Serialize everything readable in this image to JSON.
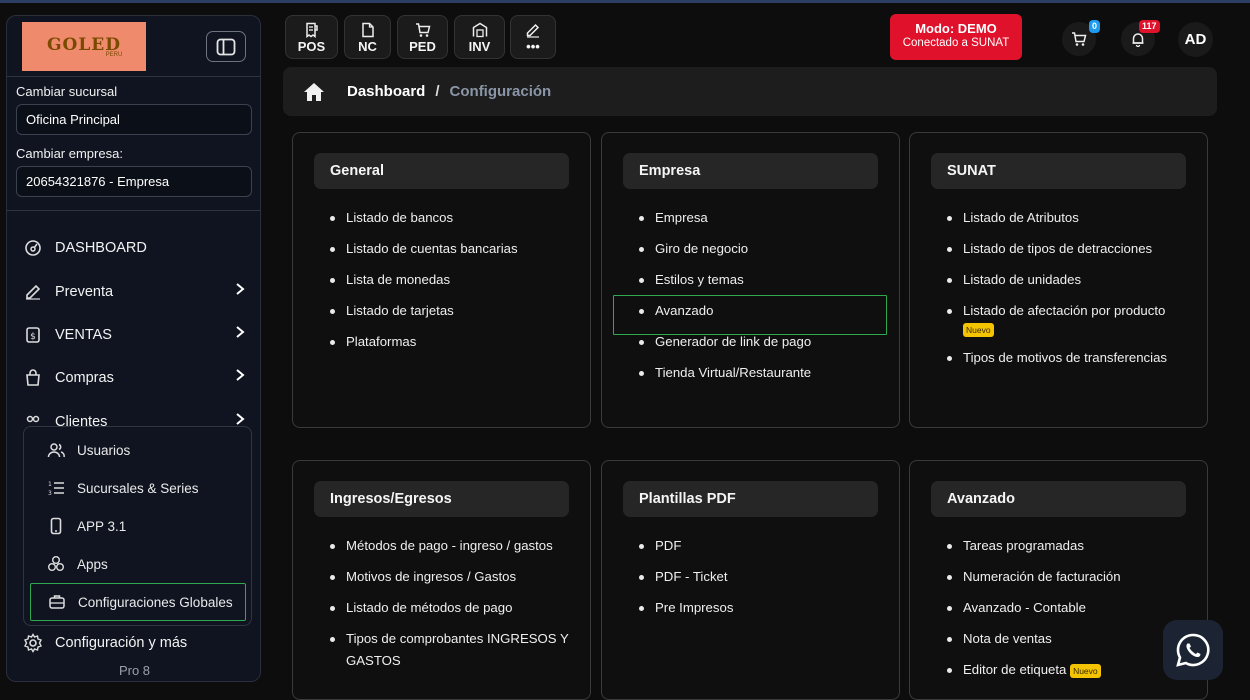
{
  "sidebar": {
    "logo_text": "GOLED",
    "logo_sub": "PERU",
    "branch_label": "Cambiar sucursal",
    "branch_value": "Oficina Principal",
    "company_label": "Cambiar empresa:",
    "company_value": "20654321876 - Empresa",
    "nav": [
      {
        "label": "DASHBOARD",
        "icon": "dashboard-icon"
      },
      {
        "label": "Preventa",
        "icon": "edit-icon"
      },
      {
        "label": "VENTAS",
        "icon": "money-icon"
      },
      {
        "label": "Compras",
        "icon": "bag-icon"
      },
      {
        "label": "Clientes",
        "icon": "users-icon"
      }
    ],
    "submenu": [
      {
        "label": "Usuarios",
        "icon": "users-icon"
      },
      {
        "label": "Sucursales & Series",
        "icon": "list-icon"
      },
      {
        "label": "APP 3.1",
        "icon": "phone-icon"
      },
      {
        "label": "Apps",
        "icon": "apps-icon"
      },
      {
        "label": "Configuraciones Globales",
        "icon": "briefcase-icon",
        "selected": true
      }
    ],
    "settings_label": "Configuración y más",
    "version": "Pro 8"
  },
  "toolbar": [
    {
      "label": "POS",
      "icon": "receipt-icon"
    },
    {
      "label": "NC",
      "icon": "file-icon"
    },
    {
      "label": "PED",
      "icon": "cart-icon"
    },
    {
      "label": "INV",
      "icon": "warehouse-icon"
    },
    {
      "label": "•••",
      "icon": "edit-icon"
    }
  ],
  "demo": {
    "title": "Modo: DEMO",
    "subtitle": "Conectado a SUNAT"
  },
  "cart_count": "0",
  "notif_count": "117",
  "avatar": "AD",
  "breadcrumb": {
    "home": "home-icon",
    "first": "Dashboard",
    "separator": "/",
    "current": "Configuración"
  },
  "nuevo_label": "Nuevo",
  "cards": [
    {
      "title": "General",
      "items": [
        "Listado de bancos",
        "Listado de cuentas bancarias",
        "Lista de monedas",
        "Listado de tarjetas",
        "Plataformas"
      ]
    },
    {
      "title": "Empresa",
      "items": [
        "Empresa",
        "Giro de negocio",
        "Estilos y temas",
        "Avanzado",
        "Generador de link de pago",
        "Tienda Virtual/Restaurante"
      ]
    },
    {
      "title": "SUNAT",
      "items": [
        "Listado de Atributos",
        "Listado de tipos de detracciones",
        "Listado de unidades",
        "Listado de afectación por producto",
        "Tipos de motivos de transferencias"
      ]
    },
    {
      "title": "Ingresos/Egresos",
      "items": [
        "Métodos de pago - ingreso / gastos",
        "Motivos de ingresos / Gastos",
        "Listado de métodos de pago",
        "Tipos de comprobantes INGRESOS Y GASTOS"
      ]
    },
    {
      "title": "Plantillas PDF",
      "items": [
        "PDF",
        "PDF - Ticket",
        "Pre Impresos"
      ]
    },
    {
      "title": "Avanzado",
      "items": [
        "Tareas programadas",
        "Numeración de facturación",
        "Avanzado - Contable",
        "Nota de ventas",
        "Editor de etiqueta"
      ]
    }
  ],
  "colors": {
    "demo": "#e0112b",
    "highlight": "#2fa84f",
    "cart_badge": "#1e9bf0",
    "notif_badge": "#e0112b",
    "nuevo": "#f5c400"
  }
}
